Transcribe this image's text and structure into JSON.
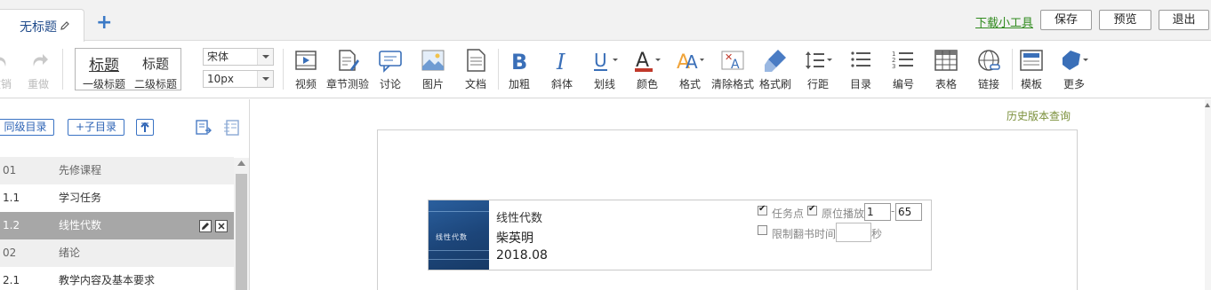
{
  "tabbar": {
    "tab_title": "无标题",
    "download_link": "下载小工具",
    "save_label": "保存",
    "preview_label": "预览",
    "exit_label": "退出"
  },
  "toolbar": {
    "undo_label": "撤销",
    "redo_label": "重做",
    "heading1_sample": "标题",
    "heading1_label": "一级标题",
    "heading2_sample": "标题",
    "heading2_label": "二级标题",
    "font_family_value": "宋体",
    "font_size_value": "10px",
    "buttons": [
      {
        "label": "视频",
        "icon": "video-icon"
      },
      {
        "label": "章节测验",
        "icon": "quiz-icon"
      },
      {
        "label": "讨论",
        "icon": "discussion-icon"
      },
      {
        "label": "图片",
        "icon": "image-icon"
      },
      {
        "label": "文档",
        "icon": "document-icon"
      },
      {
        "label": "加粗",
        "icon": "bold-icon"
      },
      {
        "label": "斜体",
        "icon": "italic-icon"
      },
      {
        "label": "划线",
        "icon": "underline-icon"
      },
      {
        "label": "颜色",
        "icon": "font-color-icon"
      },
      {
        "label": "格式",
        "icon": "format-icon"
      },
      {
        "label": "清除格式",
        "icon": "clear-format-icon"
      },
      {
        "label": "格式刷",
        "icon": "format-brush-icon"
      },
      {
        "label": "行距",
        "icon": "line-spacing-icon"
      },
      {
        "label": "目录",
        "icon": "list-icon"
      },
      {
        "label": "编号",
        "icon": "numbered-list-icon"
      },
      {
        "label": "表格",
        "icon": "table-icon"
      },
      {
        "label": "链接",
        "icon": "link-icon"
      },
      {
        "label": "模板",
        "icon": "template-icon"
      },
      {
        "label": "更多",
        "icon": "more-icon"
      }
    ]
  },
  "outline": {
    "same_level_btn": "同级目录",
    "child_btn": "+子目录",
    "rows": [
      {
        "num": "01",
        "title": "先修课程",
        "kind": "chapter"
      },
      {
        "num": "1.1",
        "title": "学习任务",
        "kind": "normal"
      },
      {
        "num": "1.2",
        "title": "线性代数",
        "kind": "selected"
      },
      {
        "num": "02",
        "title": "绪论",
        "kind": "chapter"
      },
      {
        "num": "2.1",
        "title": "教学内容及基本要求",
        "kind": "normal"
      }
    ]
  },
  "main": {
    "history_link": "历史版本查询",
    "book": {
      "cover_title": "线性代数",
      "title": "线性代数",
      "author": "柴英明",
      "date": "2018.08",
      "task_point_label": "任务点",
      "task_point_checked": true,
      "inplace_play_label": "原位播放",
      "inplace_play_checked": true,
      "page_from": "1",
      "page_dash": "-",
      "page_to": "65",
      "limit_flip_label": "限制翻书时间",
      "limit_flip_checked": false,
      "limit_seconds": "",
      "seconds_unit": "秒"
    }
  }
}
